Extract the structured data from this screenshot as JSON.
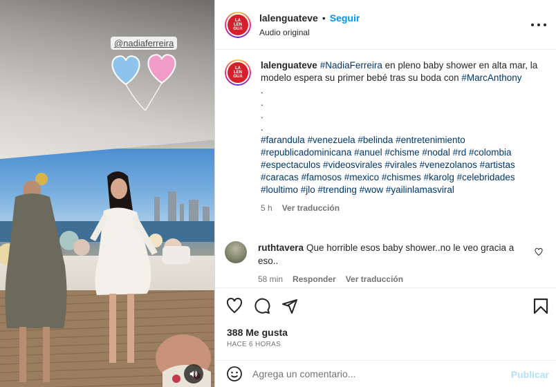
{
  "media": {
    "mention": "@nadiaferreira",
    "logo_text": "LA LEN GUA"
  },
  "header": {
    "username": "lalenguateve",
    "separator": "•",
    "follow_label": "Seguir",
    "audio_label": "Audio original"
  },
  "caption": {
    "username": "lalenguateve",
    "tag_nadia": "#NadiaFerreira",
    "text_1": " en pleno baby shower en alta mar, la modelo espera su primer bebé tras su boda con ",
    "tag_marc": "#MarcAnthony",
    "dots": [
      ".",
      ".",
      ".",
      "."
    ],
    "hashtags": "#farandula #venezuela #belinda #entretenimiento #republicadominicana #anuel #chisme #nodal #rd #colombia #espectaculos #videosvirales #virales #venezolanos #artistas #caracas #famosos #mexico #chismes #karolg #celebridades #loultimo #jlo #trending #wow #yailinlamasviral",
    "age": "5 h",
    "translate": "Ver traducción"
  },
  "comment": {
    "username": "ruthtavera",
    "text": "Que horrible esos baby shower..no le veo gracia a eso..",
    "age": "58 min",
    "reply": "Responder",
    "translate": "Ver traducción"
  },
  "stats": {
    "likes": "388 Me gusta",
    "posted": "HACE 6 HORAS"
  },
  "composer": {
    "placeholder": "Agrega un comentario...",
    "publish_label": "Publicar"
  }
}
